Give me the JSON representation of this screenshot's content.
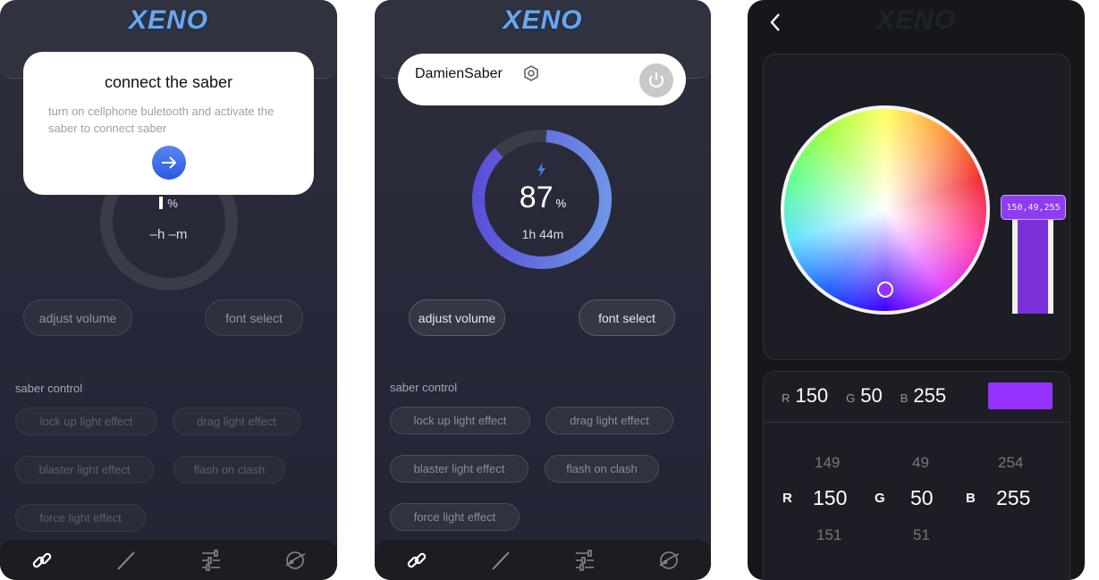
{
  "logo": "XENO",
  "screen1": {
    "dialog": {
      "title": "connect the saber",
      "message": "turn on cellphone buletooth and activate the saber to connect saber",
      "next_icon": "arrow-right-icon",
      "accent": "#3a6ae6"
    },
    "battery": {
      "percent_value": "",
      "percent_unit": "%",
      "time": "–h –m"
    },
    "buttons": {
      "adjust_volume": "adjust volume",
      "font_select": "font select"
    },
    "saber_control": {
      "label": "saber control",
      "items": [
        "lock up light effect",
        "drag light effect",
        "blaster light effect",
        "flash on clash",
        "force light effect"
      ]
    },
    "nav": [
      "link-icon",
      "saber-icon",
      "sliders-icon",
      "planet-icon"
    ]
  },
  "screen2": {
    "device": {
      "name": "DamienSaber",
      "settings_icon": "gear-icon",
      "power_icon": "power-icon"
    },
    "battery": {
      "percent": 87,
      "percent_value": "87",
      "percent_unit": "%",
      "time": "1h 44m",
      "color": "#6a7ae0"
    },
    "buttons": {
      "adjust_volume": "adjust volume",
      "font_select": "font select"
    },
    "saber_control": {
      "label": "saber control",
      "items": [
        "lock up light effect",
        "drag light effect",
        "blaster light effect",
        "flash on clash",
        "force light effect"
      ]
    }
  },
  "screen3": {
    "back_icon": "chevron-left-icon",
    "slider_label": "150,49,255",
    "rgb": {
      "r_label": "R",
      "r": "150",
      "g_label": "G",
      "g": "50",
      "b_label": "B",
      "b": "255",
      "swatch": "#9632ff"
    },
    "picker": {
      "r": {
        "label": "R",
        "prev": "149",
        "value": "150",
        "next": "151"
      },
      "g": {
        "label": "G",
        "prev": "49",
        "value": "50",
        "next": "51"
      },
      "b": {
        "label": "B",
        "prev": "254",
        "value": "255",
        "next": ""
      }
    }
  }
}
